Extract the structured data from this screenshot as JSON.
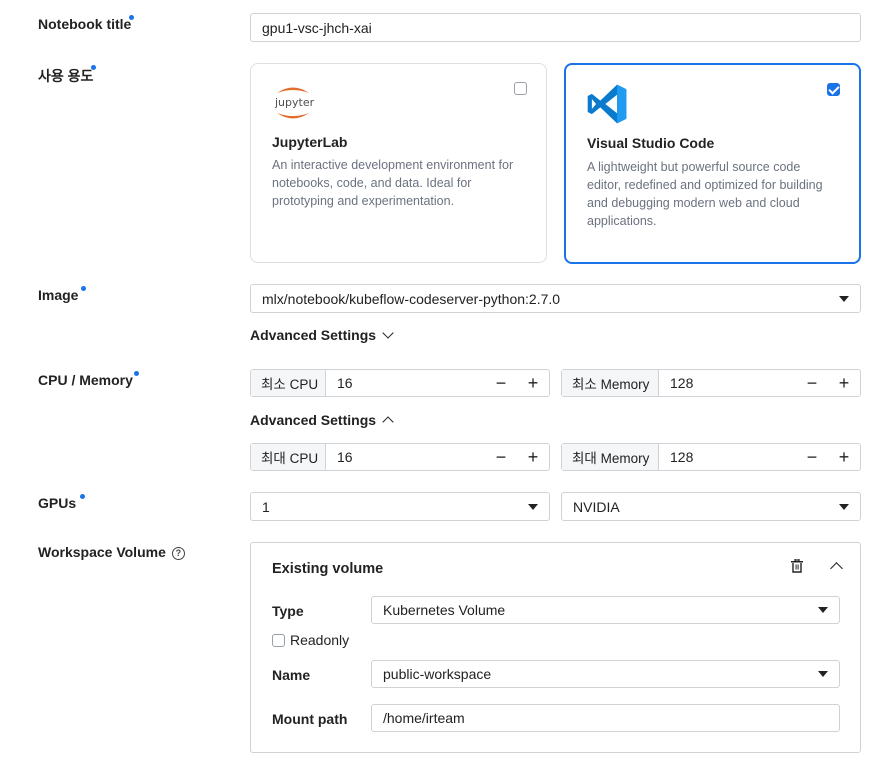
{
  "notebook_title": {
    "label": "Notebook title",
    "value": "gpu1-vsc-jhch-xai"
  },
  "usage": {
    "label": "사용 용도",
    "options": [
      {
        "logo_text": "jupyter",
        "title": "JupyterLab",
        "desc": "An interactive development environment for notebooks, code, and data. Ideal for prototyping and experimentation.",
        "selected": false
      },
      {
        "logo": "vscode-logo",
        "title": "Visual Studio Code",
        "desc": "A lightweight but powerful source code editor, redefined and optimized for building and debugging modern web and cloud applications.",
        "selected": true
      }
    ]
  },
  "image": {
    "label": "Image",
    "value": "mlx/notebook/kubeflow-codeserver-python:2.7.0",
    "advanced_label": "Advanced Settings"
  },
  "cpu_memory": {
    "label": "CPU / Memory",
    "min_cpu_label": "최소 CPU",
    "min_cpu": "16",
    "min_mem_label": "최소 Memory",
    "min_mem": "128",
    "advanced_label": "Advanced Settings",
    "max_cpu_label": "최대 CPU",
    "max_cpu": "16",
    "max_mem_label": "최대 Memory",
    "max_mem": "128"
  },
  "gpus": {
    "label": "GPUs",
    "count": "1",
    "vendor": "NVIDIA"
  },
  "workspace": {
    "label": "Workspace Volume",
    "help_icon": "?",
    "card_title": "Existing volume",
    "type_label": "Type",
    "type_value": "Kubernetes Volume",
    "readonly_label": "Readonly",
    "name_label": "Name",
    "name_value": "public-workspace",
    "mount_label": "Mount path",
    "mount_value": "/home/irteam"
  },
  "colors": {
    "accent": "#1a73e8",
    "vscode_blue": "#0a7acc",
    "jupyter_orange": "#e46e2e"
  }
}
